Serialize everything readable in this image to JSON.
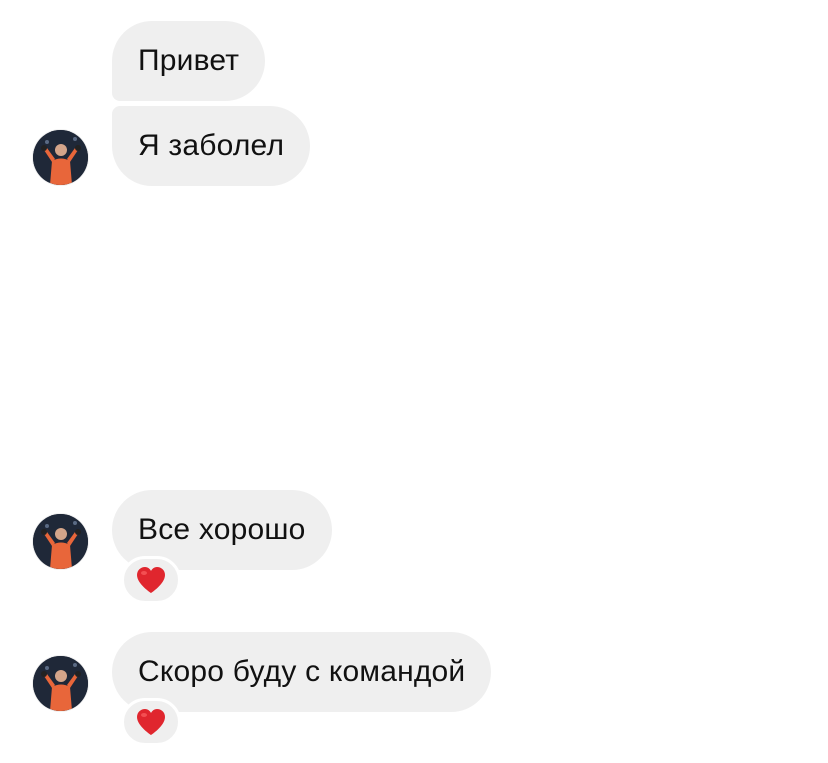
{
  "thread": {
    "messages": [
      {
        "text": "Привет"
      },
      {
        "text": "Я заболел"
      },
      {
        "text": "Все хорошо",
        "reaction": "heart-icon"
      },
      {
        "text": "Скоро буду с командой",
        "reaction": "heart-icon"
      }
    ]
  },
  "theme": {
    "bubble_bg": "#efefef",
    "reaction_color": "#e0262e",
    "avatar_jersey": "#e8663a"
  }
}
